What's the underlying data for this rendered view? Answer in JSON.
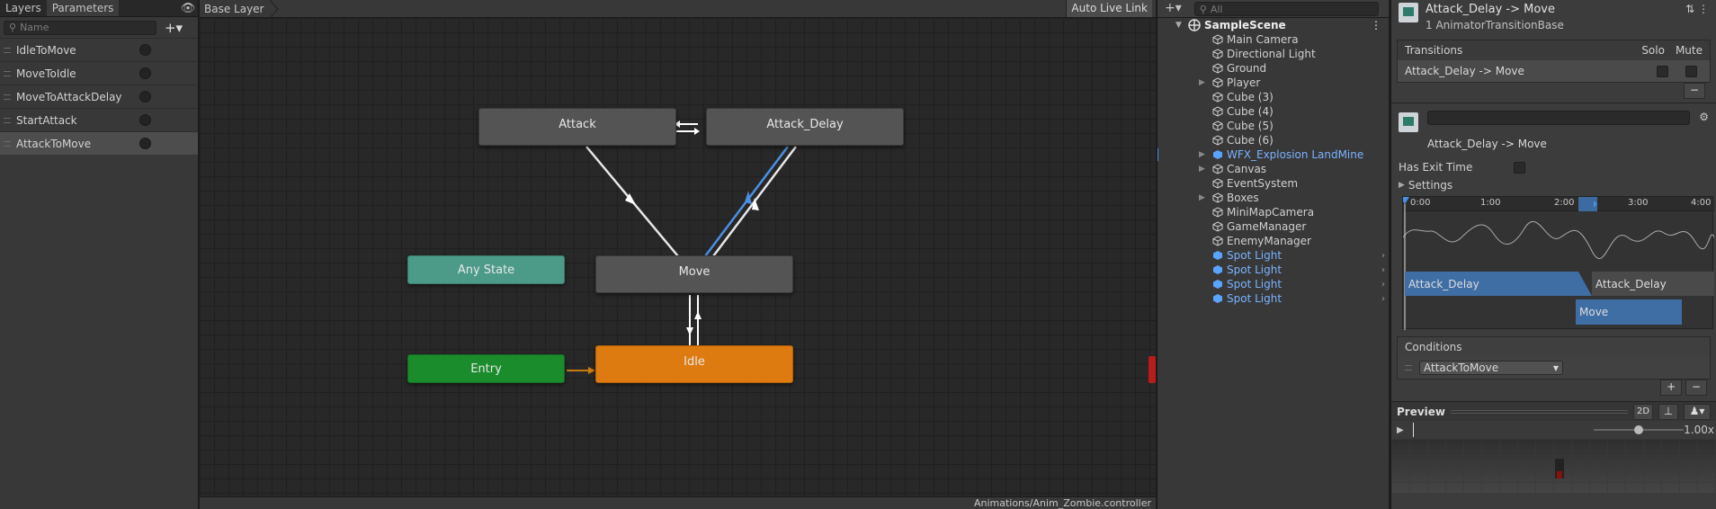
{
  "left_panel": {
    "tabs": [
      "Layers",
      "Parameters"
    ],
    "search_placeholder": "Name",
    "add_label": "+▾",
    "parameters": [
      "IdleToMove",
      "MoveToIdle",
      "MoveToAttackDelay",
      "StartAttack",
      "AttackToMove"
    ],
    "selected_parameter": "AttackToMove"
  },
  "graph": {
    "breadcrumb": "Base Layer",
    "auto_live_link": "Auto Live Link",
    "footer_path": "Animations/Anim_Zombie.controller",
    "states": {
      "attack": "Attack",
      "attack_delay": "Attack_Delay",
      "any_state": "Any State",
      "move": "Move",
      "entry": "Entry",
      "idle": "Idle"
    },
    "colors": {
      "any_state": "#4b9b88",
      "entry": "#1a8c2c",
      "idle": "#dd7a10",
      "default_state": "#545454",
      "selected_transition": "#4a90e2"
    }
  },
  "hierarchy": {
    "add_label": "+▾",
    "search_placeholder": "All",
    "scene_name": "SampleScene",
    "items": [
      {
        "label": "Main Camera",
        "expandable": false,
        "prefab": false
      },
      {
        "label": "Directional Light",
        "expandable": false,
        "prefab": false
      },
      {
        "label": "Ground",
        "expandable": false,
        "prefab": false
      },
      {
        "label": "Player",
        "expandable": true,
        "prefab": false
      },
      {
        "label": "Cube (3)",
        "expandable": false,
        "prefab": false
      },
      {
        "label": "Cube (4)",
        "expandable": false,
        "prefab": false
      },
      {
        "label": "Cube (5)",
        "expandable": false,
        "prefab": false
      },
      {
        "label": "Cube (6)",
        "expandable": false,
        "prefab": false
      },
      {
        "label": "WFX_Explosion LandMine",
        "expandable": true,
        "prefab": true
      },
      {
        "label": "Canvas",
        "expandable": true,
        "prefab": false
      },
      {
        "label": "EventSystem",
        "expandable": false,
        "prefab": false
      },
      {
        "label": "Boxes",
        "expandable": true,
        "prefab": false
      },
      {
        "label": "MiniMapCamera",
        "expandable": false,
        "prefab": false
      },
      {
        "label": "GameManager",
        "expandable": false,
        "prefab": false
      },
      {
        "label": "EnemyManager",
        "expandable": false,
        "prefab": false
      },
      {
        "label": "Spot Light",
        "expandable": false,
        "prefab": true
      },
      {
        "label": "Spot Light",
        "expandable": false,
        "prefab": true
      },
      {
        "label": "Spot Light",
        "expandable": false,
        "prefab": true
      },
      {
        "label": "Spot Light",
        "expandable": false,
        "prefab": true
      }
    ]
  },
  "inspector": {
    "title": "Attack_Delay -> Move",
    "subtitle": "1 AnimatorTransitionBase",
    "transitions_header": "Transitions",
    "solo_label": "Solo",
    "mute_label": "Mute",
    "transition_row": "Attack_Delay -> Move",
    "minus": "−",
    "transition_name": "Attack_Delay -> Move",
    "has_exit_time_label": "Has Exit Time",
    "settings_label": "Settings",
    "timeline_ticks": [
      "0:00",
      "1:00",
      "2:00",
      "3:00",
      "4:00"
    ],
    "timeline_from": "Attack_Delay",
    "timeline_from2": "Attack_Delay",
    "timeline_to": "Move",
    "conditions_label": "Conditions",
    "condition_param": "AttackToMove",
    "plus": "+",
    "preview_label": "Preview",
    "mode_2d": "2D",
    "speed": "1.00x"
  }
}
